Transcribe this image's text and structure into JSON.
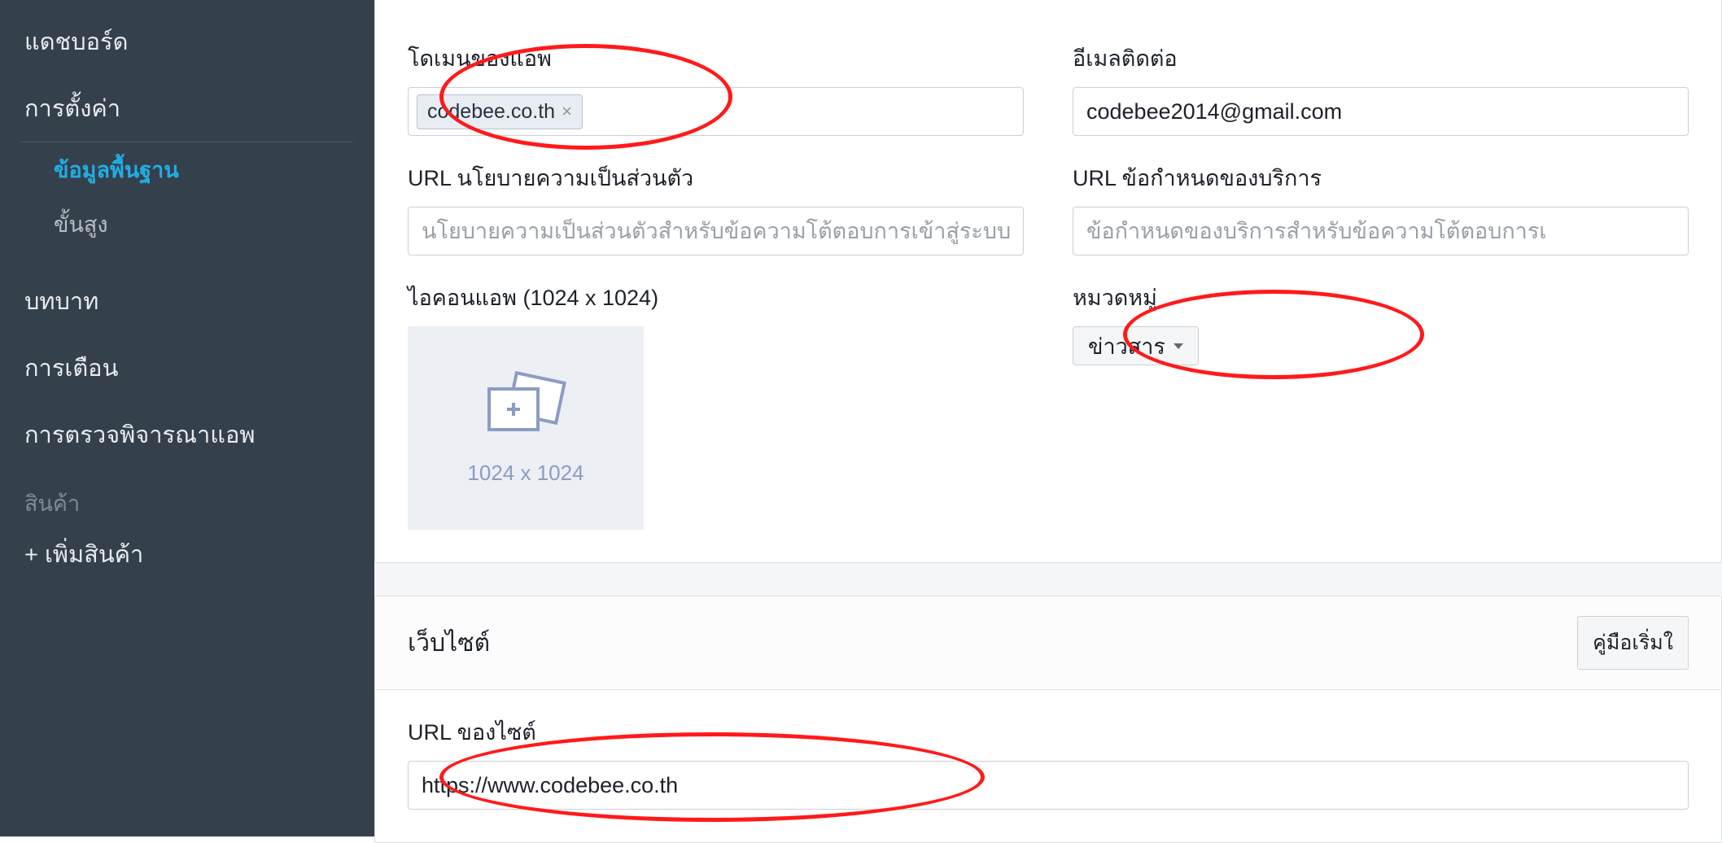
{
  "sidebar": {
    "dashboard": "แดชบอร์ด",
    "settings": "การตั้งค่า",
    "settings_sub": {
      "basic": "ข้อมูลพื้นฐาน",
      "advanced": "ขั้นสูง"
    },
    "roles": "บทบาท",
    "alerts": "การเตือน",
    "appreview": "การตรวจพิจารณาแอพ",
    "products_label": "สินค้า",
    "add_product": "+ เพิ่มสินค้า"
  },
  "form": {
    "app_domain_label": "โดเมนของแอพ",
    "app_domain_tag": "codebee.co.th",
    "contact_email_label": "อีเมลติดต่อ",
    "contact_email_value": "codebee2014@gmail.com",
    "privacy_url_label": "URL นโยบายความเป็นส่วนตัว",
    "privacy_url_placeholder": "นโยบายความเป็นส่วนตัวสำหรับข้อความโต้ตอบการเข้าสู่ระบบ",
    "tos_url_label": "URL ข้อกำหนดของบริการ",
    "tos_url_placeholder": "ข้อกำหนดของบริการสำหรับข้อความโต้ตอบการเ",
    "app_icon_label": "ไอคอนแอพ (1024 x 1024)",
    "app_icon_dim": "1024 x 1024",
    "category_label": "หมวดหมู่",
    "category_value": "ข่าวสาร"
  },
  "website": {
    "title": "เว็บไซต์",
    "guide_btn": "คู่มือเริ่มใ",
    "site_url_label": "URL ของไซต์",
    "site_url_value": "https://www.codebee.co.th"
  }
}
